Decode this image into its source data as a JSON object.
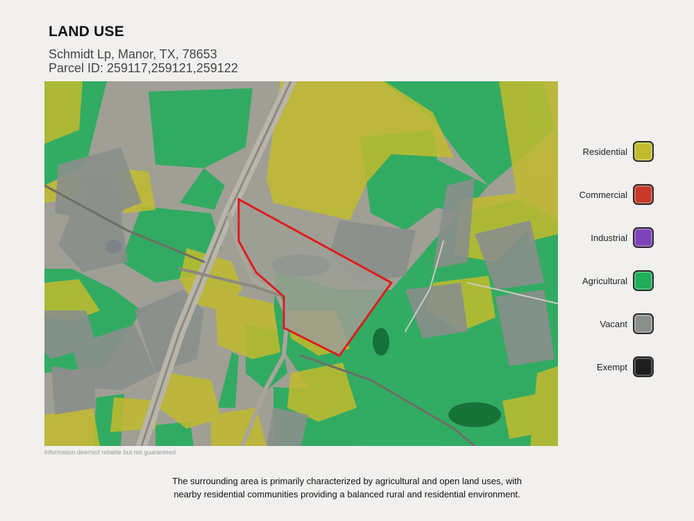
{
  "header": {
    "title": "LAND USE",
    "address": "Schmidt Lp, Manor, TX, 78653",
    "parcel_id": "Parcel ID: 259117,259121,259122"
  },
  "legend": {
    "items": [
      {
        "label": "Residential",
        "color": "#c2bb2e"
      },
      {
        "label": "Commercial",
        "color": "#c53a2a"
      },
      {
        "label": "Industrial",
        "color": "#7d43b8"
      },
      {
        "label": "Agricultural",
        "color": "#1fae5a"
      },
      {
        "label": "Vacant",
        "color": "#8a8f8c"
      },
      {
        "label": "Exempt",
        "color": "#1e1e1e"
      }
    ]
  },
  "map": {
    "parcel_outline_color": "#e01b1b"
  },
  "footer": {
    "disclaimer": "information deemed reliable but not guaranteed",
    "summary_line1": "The surrounding area is primarily characterized by agricultural and open land uses, with",
    "summary_line2": "nearby residential communities providing a balanced rural and residential environment."
  }
}
